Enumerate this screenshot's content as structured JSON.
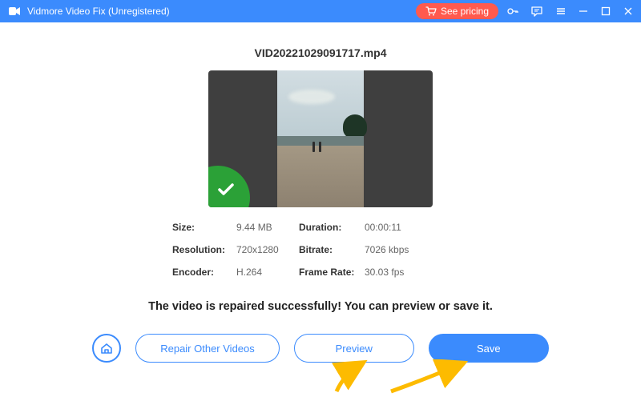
{
  "titlebar": {
    "app_title": "Vidmore Video Fix (Unregistered)",
    "see_pricing": "See pricing"
  },
  "file": {
    "name": "VID20221029091717.mp4"
  },
  "meta": {
    "size_label": "Size:",
    "size_value": "9.44 MB",
    "duration_label": "Duration:",
    "duration_value": "00:00:11",
    "resolution_label": "Resolution:",
    "resolution_value": "720x1280",
    "bitrate_label": "Bitrate:",
    "bitrate_value": "7026 kbps",
    "encoder_label": "Encoder:",
    "encoder_value": "H.264",
    "framerate_label": "Frame Rate:",
    "framerate_value": "30.03 fps"
  },
  "messages": {
    "success": "The video is repaired successfully! You can preview or save it."
  },
  "buttons": {
    "repair_other": "Repair Other Videos",
    "preview": "Preview",
    "save": "Save"
  }
}
